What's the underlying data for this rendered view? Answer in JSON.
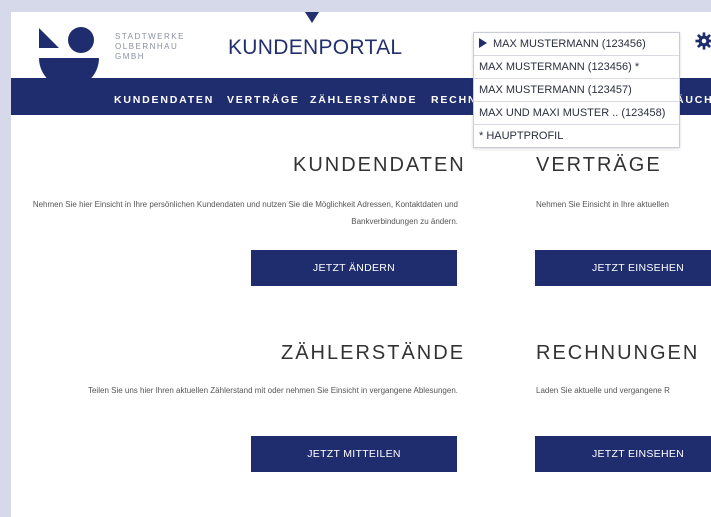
{
  "company": {
    "line1": "STADTWERKE",
    "line2": "OLBERNHAU",
    "line3": "GMBH"
  },
  "portal_title": "KUNDENPORTAL",
  "nav": [
    "KUNDENDATEN",
    "VERTRÄGE",
    "ZÄHLERSTÄNDE",
    "RECHN",
    "ÄUCH"
  ],
  "profile_dropdown": {
    "selected": "MAX MUSTERMANN  (123456)",
    "options": [
      "MAX MUSTERMANN  (123456) *",
      "MAX MUSTERMANN  (123457)",
      "MAX UND MAXI MUSTER .. (123458)",
      "* HAUPTPROFIL"
    ]
  },
  "sections": {
    "kundendaten": {
      "title": "KUNDENDATEN",
      "text": "Nehmen Sie hier Einsicht in Ihre persönlichen Kundendaten und nutzen Sie die Möglichkeit Adressen, Kontaktdaten und Bankverbindungen zu ändern.",
      "button": "JETZT ÄNDERN"
    },
    "vertraege": {
      "title": "VERTRÄGE",
      "text": "Nehmen Sie Einsicht in Ihre aktuellen",
      "button": "JETZT EINSEHEN"
    },
    "zaehlerstaende": {
      "title": "ZÄHLERSTÄNDE",
      "text": "Teilen Sie uns hier Ihren aktuellen Zählerstand mit oder nehmen Sie Einsicht in vergangene Ablesungen.",
      "button": "JETZT MITTEILEN"
    },
    "rechnungen": {
      "title": "RECHNUNGEN",
      "text": "Laden Sie aktuelle und vergangene R",
      "button": "JETZT EINSEHEN"
    }
  },
  "colors": {
    "brand": "#1f2d6e",
    "background": "#d5d9ea"
  },
  "icons": [
    "logo-icon",
    "gear-icon",
    "dropdown-pointer-icon",
    "play-arrow-icon"
  ]
}
